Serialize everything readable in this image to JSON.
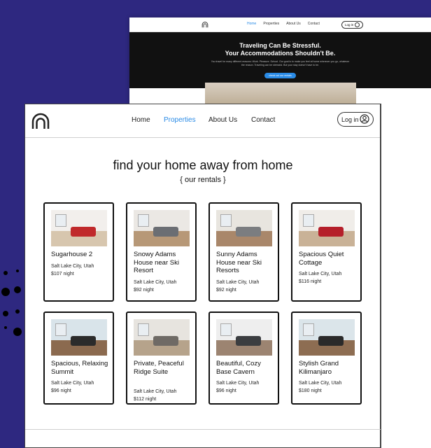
{
  "back_site": {
    "nav": [
      "Home",
      "Properties",
      "About Us",
      "Contact"
    ],
    "login": "Log in",
    "hero_title_1": "Traveling Can Be Stressful.",
    "hero_title_2": "Your Accommodations Shouldn't Be.",
    "hero_text": "You travel for many different reasons: Work. Pleasure. School. Our goal is to make you feel at home wherever you go, whatever the reason. Traveling can be stressful. But your stay doesn't have to be.",
    "cta": "check out our rentals"
  },
  "nav": {
    "home": "Home",
    "properties": "Properties",
    "about": "About Us",
    "contact": "Contact",
    "login": "Log in"
  },
  "heading": "find your home away from home",
  "subheading": "{ our rentals }",
  "colors": {
    "accent": "#2a8be6",
    "background": "#2e2880"
  },
  "listings": [
    {
      "name": "Sugarhouse 2",
      "location": "Salt Lake City, Utah",
      "price": "$107 night"
    },
    {
      "name": "Snowy Adams House near Ski Resort",
      "location": "Salt Lake City, Utah",
      "price": "$92 night"
    },
    {
      "name": "Sunny Adams House near Ski Resorts",
      "location": "Salt Lake City, Utah",
      "price": "$92 night"
    },
    {
      "name": "Spacious Quiet Cottage",
      "location": "Salt Lake City, Utah",
      "price": "$116 night"
    },
    {
      "name": "Spacious, Relaxing Summit",
      "location": "Salt Lake City, Utah",
      "price": "$96 night"
    },
    {
      "name": "Private, Peaceful Ridge Suite",
      "location": "Salt Lake City, Utah",
      "price": "$112 night"
    },
    {
      "name": "Beautiful, Cozy Base Cavern",
      "location": "Salt Lake City, Utah",
      "price": "$96 night"
    },
    {
      "name": "Stylish Grand Kilimanjaro",
      "location": "Salt Lake City, Utah",
      "price": "$180 night"
    }
  ]
}
